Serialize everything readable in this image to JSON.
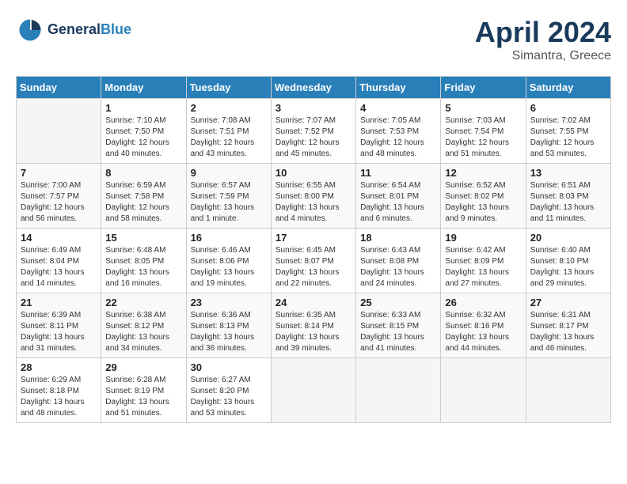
{
  "header": {
    "logo_line1": "General",
    "logo_line2": "Blue",
    "month": "April 2024",
    "location": "Simantra, Greece"
  },
  "weekdays": [
    "Sunday",
    "Monday",
    "Tuesday",
    "Wednesday",
    "Thursday",
    "Friday",
    "Saturday"
  ],
  "weeks": [
    [
      {
        "day": "",
        "sunrise": "",
        "sunset": "",
        "daylight": ""
      },
      {
        "day": "1",
        "sunrise": "Sunrise: 7:10 AM",
        "sunset": "Sunset: 7:50 PM",
        "daylight": "Daylight: 12 hours and 40 minutes."
      },
      {
        "day": "2",
        "sunrise": "Sunrise: 7:08 AM",
        "sunset": "Sunset: 7:51 PM",
        "daylight": "Daylight: 12 hours and 43 minutes."
      },
      {
        "day": "3",
        "sunrise": "Sunrise: 7:07 AM",
        "sunset": "Sunset: 7:52 PM",
        "daylight": "Daylight: 12 hours and 45 minutes."
      },
      {
        "day": "4",
        "sunrise": "Sunrise: 7:05 AM",
        "sunset": "Sunset: 7:53 PM",
        "daylight": "Daylight: 12 hours and 48 minutes."
      },
      {
        "day": "5",
        "sunrise": "Sunrise: 7:03 AM",
        "sunset": "Sunset: 7:54 PM",
        "daylight": "Daylight: 12 hours and 51 minutes."
      },
      {
        "day": "6",
        "sunrise": "Sunrise: 7:02 AM",
        "sunset": "Sunset: 7:55 PM",
        "daylight": "Daylight: 12 hours and 53 minutes."
      }
    ],
    [
      {
        "day": "7",
        "sunrise": "Sunrise: 7:00 AM",
        "sunset": "Sunset: 7:57 PM",
        "daylight": "Daylight: 12 hours and 56 minutes."
      },
      {
        "day": "8",
        "sunrise": "Sunrise: 6:59 AM",
        "sunset": "Sunset: 7:58 PM",
        "daylight": "Daylight: 12 hours and 58 minutes."
      },
      {
        "day": "9",
        "sunrise": "Sunrise: 6:57 AM",
        "sunset": "Sunset: 7:59 PM",
        "daylight": "Daylight: 13 hours and 1 minute."
      },
      {
        "day": "10",
        "sunrise": "Sunrise: 6:55 AM",
        "sunset": "Sunset: 8:00 PM",
        "daylight": "Daylight: 13 hours and 4 minutes."
      },
      {
        "day": "11",
        "sunrise": "Sunrise: 6:54 AM",
        "sunset": "Sunset: 8:01 PM",
        "daylight": "Daylight: 13 hours and 6 minutes."
      },
      {
        "day": "12",
        "sunrise": "Sunrise: 6:52 AM",
        "sunset": "Sunset: 8:02 PM",
        "daylight": "Daylight: 13 hours and 9 minutes."
      },
      {
        "day": "13",
        "sunrise": "Sunrise: 6:51 AM",
        "sunset": "Sunset: 8:03 PM",
        "daylight": "Daylight: 13 hours and 11 minutes."
      }
    ],
    [
      {
        "day": "14",
        "sunrise": "Sunrise: 6:49 AM",
        "sunset": "Sunset: 8:04 PM",
        "daylight": "Daylight: 13 hours and 14 minutes."
      },
      {
        "day": "15",
        "sunrise": "Sunrise: 6:48 AM",
        "sunset": "Sunset: 8:05 PM",
        "daylight": "Daylight: 13 hours and 16 minutes."
      },
      {
        "day": "16",
        "sunrise": "Sunrise: 6:46 AM",
        "sunset": "Sunset: 8:06 PM",
        "daylight": "Daylight: 13 hours and 19 minutes."
      },
      {
        "day": "17",
        "sunrise": "Sunrise: 6:45 AM",
        "sunset": "Sunset: 8:07 PM",
        "daylight": "Daylight: 13 hours and 22 minutes."
      },
      {
        "day": "18",
        "sunrise": "Sunrise: 6:43 AM",
        "sunset": "Sunset: 8:08 PM",
        "daylight": "Daylight: 13 hours and 24 minutes."
      },
      {
        "day": "19",
        "sunrise": "Sunrise: 6:42 AM",
        "sunset": "Sunset: 8:09 PM",
        "daylight": "Daylight: 13 hours and 27 minutes."
      },
      {
        "day": "20",
        "sunrise": "Sunrise: 6:40 AM",
        "sunset": "Sunset: 8:10 PM",
        "daylight": "Daylight: 13 hours and 29 minutes."
      }
    ],
    [
      {
        "day": "21",
        "sunrise": "Sunrise: 6:39 AM",
        "sunset": "Sunset: 8:11 PM",
        "daylight": "Daylight: 13 hours and 31 minutes."
      },
      {
        "day": "22",
        "sunrise": "Sunrise: 6:38 AM",
        "sunset": "Sunset: 8:12 PM",
        "daylight": "Daylight: 13 hours and 34 minutes."
      },
      {
        "day": "23",
        "sunrise": "Sunrise: 6:36 AM",
        "sunset": "Sunset: 8:13 PM",
        "daylight": "Daylight: 13 hours and 36 minutes."
      },
      {
        "day": "24",
        "sunrise": "Sunrise: 6:35 AM",
        "sunset": "Sunset: 8:14 PM",
        "daylight": "Daylight: 13 hours and 39 minutes."
      },
      {
        "day": "25",
        "sunrise": "Sunrise: 6:33 AM",
        "sunset": "Sunset: 8:15 PM",
        "daylight": "Daylight: 13 hours and 41 minutes."
      },
      {
        "day": "26",
        "sunrise": "Sunrise: 6:32 AM",
        "sunset": "Sunset: 8:16 PM",
        "daylight": "Daylight: 13 hours and 44 minutes."
      },
      {
        "day": "27",
        "sunrise": "Sunrise: 6:31 AM",
        "sunset": "Sunset: 8:17 PM",
        "daylight": "Daylight: 13 hours and 46 minutes."
      }
    ],
    [
      {
        "day": "28",
        "sunrise": "Sunrise: 6:29 AM",
        "sunset": "Sunset: 8:18 PM",
        "daylight": "Daylight: 13 hours and 48 minutes."
      },
      {
        "day": "29",
        "sunrise": "Sunrise: 6:28 AM",
        "sunset": "Sunset: 8:19 PM",
        "daylight": "Daylight: 13 hours and 51 minutes."
      },
      {
        "day": "30",
        "sunrise": "Sunrise: 6:27 AM",
        "sunset": "Sunset: 8:20 PM",
        "daylight": "Daylight: 13 hours and 53 minutes."
      },
      {
        "day": "",
        "sunrise": "",
        "sunset": "",
        "daylight": ""
      },
      {
        "day": "",
        "sunrise": "",
        "sunset": "",
        "daylight": ""
      },
      {
        "day": "",
        "sunrise": "",
        "sunset": "",
        "daylight": ""
      },
      {
        "day": "",
        "sunrise": "",
        "sunset": "",
        "daylight": ""
      }
    ]
  ]
}
